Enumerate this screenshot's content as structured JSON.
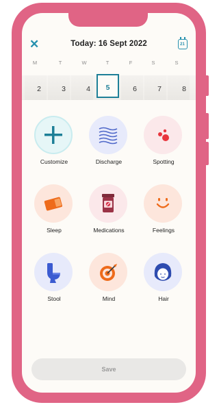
{
  "header": {
    "title": "Today: 16 Sept 2022",
    "calendar_day": "21"
  },
  "weekdays": [
    "M",
    "T",
    "W",
    "T",
    "F",
    "S",
    "S"
  ],
  "dates": [
    "2",
    "3",
    "4",
    "5",
    "6",
    "7",
    "8"
  ],
  "selected_date": "5",
  "categories": [
    {
      "label": "Customize",
      "icon": "plus-icon"
    },
    {
      "label": "Discharge",
      "icon": "discharge-waves-icon"
    },
    {
      "label": "Spotting",
      "icon": "blood-drops-icon"
    },
    {
      "label": "Sleep",
      "icon": "sleep-pillow-icon"
    },
    {
      "label": "Medications",
      "icon": "pill-bottle-icon"
    },
    {
      "label": "Feelings",
      "icon": "smiley-face-icon"
    },
    {
      "label": "Stool",
      "icon": "toilet-icon"
    },
    {
      "label": "Mind",
      "icon": "target-icon"
    },
    {
      "label": "Hair",
      "icon": "hair-icon"
    }
  ],
  "save_label": "Save",
  "colors": {
    "phone_frame": "#e06485",
    "accent": "#1d7f97",
    "customize_bg": "#e6f6f7",
    "blue_bg": "#e7eafb",
    "pink_bg": "#fbe8ea",
    "peach_bg": "#fde6dc",
    "save_bg": "#e9e8e6"
  }
}
